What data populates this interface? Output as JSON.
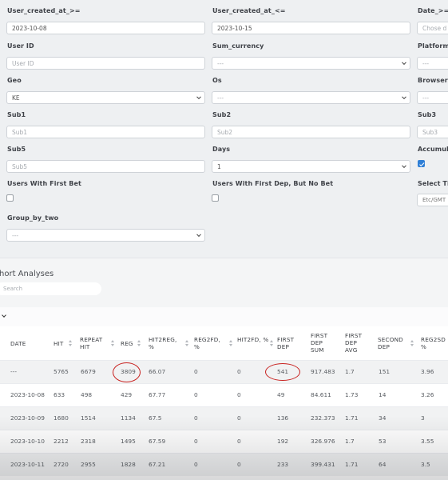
{
  "filters": {
    "user_created_from": {
      "label": "User_created_at_>=",
      "value": "2023-10-08"
    },
    "user_created_to": {
      "label": "User_created_at_<=",
      "value": "2023-10-15"
    },
    "date_from": {
      "label": "Date_>=",
      "placeholder": "Chose d"
    },
    "user_id": {
      "label": "User ID",
      "placeholder": "User ID"
    },
    "sum_currency": {
      "label": "Sum_currency",
      "value": "---"
    },
    "platform": {
      "label": "Platform",
      "value": "---"
    },
    "geo": {
      "label": "Geo",
      "value": "KE"
    },
    "os": {
      "label": "Os",
      "value": "---"
    },
    "browser": {
      "label": "Browser",
      "value": "---"
    },
    "sub1": {
      "label": "Sub1",
      "placeholder": "Sub1"
    },
    "sub2": {
      "label": "Sub2",
      "placeholder": "Sub2"
    },
    "sub3": {
      "label": "Sub3",
      "placeholder": "Sub3"
    },
    "sub5": {
      "label": "Sub5",
      "placeholder": "Sub5"
    },
    "days": {
      "label": "Days",
      "value": "1"
    },
    "accumulate": {
      "label": "Accumula",
      "checked": true
    },
    "users_first_bet": {
      "label": "Users With First Bet",
      "checked": false
    },
    "users_first_dep_no_bet": {
      "label": "Users With First Dep, But No Bet",
      "checked": false
    },
    "select_timezone": {
      "label": "Select Ti",
      "value": "Etc/GMT"
    },
    "group_by_two": {
      "label": "Group_by_two",
      "value": "---"
    }
  },
  "report": {
    "title": "hort Analyses",
    "search_placeholder": "Search"
  },
  "table": {
    "headers": [
      "DATE",
      "HIT",
      "REPEAT HIT",
      "REG",
      "HIT2REG, %",
      "REG2FD, %",
      "HIT2FD, %",
      "FIRST DEP",
      "FIRST DEP SUM",
      "FIRST DEP AVG",
      "SECOND DEP",
      "REG2SD %"
    ],
    "rows": [
      [
        "---",
        "5765",
        "6679",
        "3809",
        "66.07",
        "0",
        "0",
        "541",
        "917.483",
        "1.7",
        "151",
        "3.96"
      ],
      [
        "2023-10-08",
        "633",
        "498",
        "429",
        "67.77",
        "0",
        "0",
        "49",
        "84.611",
        "1.73",
        "14",
        "3.26"
      ],
      [
        "2023-10-09",
        "1680",
        "1514",
        "1134",
        "67.5",
        "0",
        "0",
        "136",
        "232.373",
        "1.71",
        "34",
        "3"
      ],
      [
        "2023-10-10",
        "2212",
        "2318",
        "1495",
        "67.59",
        "0",
        "0",
        "192",
        "326.976",
        "1.7",
        "53",
        "3.55"
      ],
      [
        "2023-10-11",
        "2720",
        "2955",
        "1828",
        "67.21",
        "0",
        "0",
        "233",
        "399.431",
        "1.71",
        "64",
        "3.5"
      ]
    ]
  },
  "colors": {
    "highlight": "#c8201e",
    "checkbox_on": "#2f7fd6"
  },
  "icons": [
    "chevron-down-icon",
    "sort-icon",
    "checkmark-icon"
  ]
}
